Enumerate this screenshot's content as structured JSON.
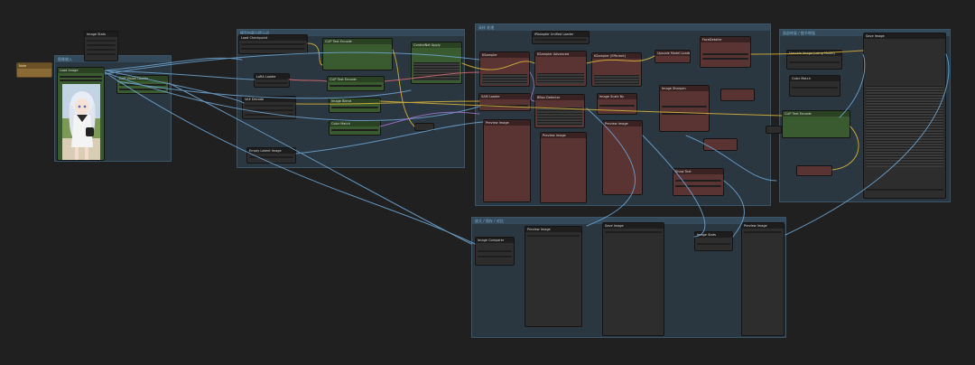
{
  "window": {
    "title": "ComfyUI node graph"
  },
  "groups": [
    {
      "id": "g1",
      "title": "图像输入"
    },
    {
      "id": "g2",
      "title": "模型加载与提示词"
    },
    {
      "id": "g3",
      "title": "采样 处理"
    },
    {
      "id": "g4",
      "title": "面部修复 / 细节增强"
    },
    {
      "id": "g5",
      "title": "放大 / 保存 / 对比"
    }
  ],
  "nodes": {
    "n_load_image": "Load Image",
    "n_reroute": "Reroute",
    "n_note": "Note",
    "n_detector": "CLIP Vision Loader",
    "n_top_small": "Image Stats",
    "n_checkpoint": "Load Checkpoint",
    "n_clip_text_pos": "CLIP Text Encode",
    "n_clip_text_neg": "CLIP Text Encode",
    "n_lora": "LoRA Loader",
    "n_controlnet": "ControlNet Apply",
    "n_ipadapter": "IPAdapter Unified Loader",
    "n_vae": "VAE Decode",
    "n_ksampler_a": "KSampler",
    "n_ksampler_b": "KSampler Advanced",
    "n_ksampler_c": "KSampler (Efficient)",
    "n_upscale_model": "Upscale Model Loader",
    "n_face_detailer": "FaceDetailer",
    "n_sam": "SAM Loader",
    "n_bbox": "BBox Detector",
    "n_latent": "Empty Latent Image",
    "n_imgscale": "Image Scale By",
    "n_preview_a": "Preview Image",
    "n_preview_b": "Preview Image",
    "n_preview_c": "Preview Image",
    "n_save": "Save Image",
    "n_compare": "Image Comparer",
    "n_upscale": "Upscale Image (using Model)",
    "n_color_match": "Color Match",
    "n_sharpen": "Image Sharpen",
    "n_blend": "Image Blend",
    "n_save2": "Save Image",
    "n_preview_d": "Preview Image",
    "n_text_out": "Show Text"
  },
  "colors": {
    "canvas": "#202020",
    "group": "#2a3640",
    "node": "#353535",
    "node_red": "#5a3333",
    "node_green": "#3a5a30",
    "wire_blue": "#6fa8d6",
    "wire_yellow": "#d4b13a",
    "wire_pink": "#e06c75",
    "wire_purple": "#a97ad6"
  }
}
